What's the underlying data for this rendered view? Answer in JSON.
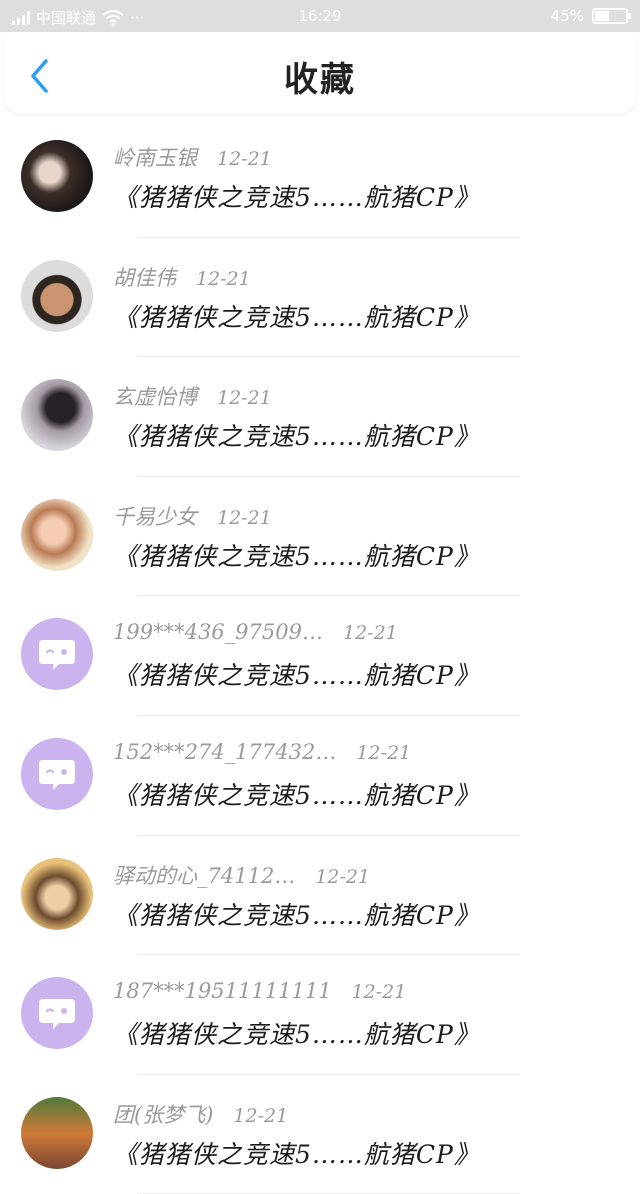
{
  "status_bar": {
    "carrier": "中国联通",
    "more": "···",
    "time": "16:29",
    "battery_pct": "45%",
    "battery_level": 0.45,
    "icons": [
      "signal-icon",
      "wifi-icon",
      "battery-icon"
    ]
  },
  "header": {
    "title": "收藏",
    "back_icon": "chevron-left-icon",
    "accent": "#2a9df4"
  },
  "items": [
    {
      "name": "岭南玉银",
      "date": "12-21",
      "title": "《猪猪侠之竞速5……航猪CP》",
      "avatar": "photo1"
    },
    {
      "name": "胡佳伟",
      "date": "12-21",
      "title": "《猪猪侠之竞速5……航猪CP》",
      "avatar": "photo2"
    },
    {
      "name": "玄虚怡博",
      "date": "12-21",
      "title": "《猪猪侠之竞速5……航猪CP》",
      "avatar": "photo3"
    },
    {
      "name": "千易少女",
      "date": "12-21",
      "title": "《猪猪侠之竞速5……航猪CP》",
      "avatar": "photo4"
    },
    {
      "name": "199***436_97509…",
      "date": "12-21",
      "title": "《猪猪侠之竞速5……航猪CP》",
      "avatar": "default"
    },
    {
      "name": "152***274_177432…",
      "date": "12-21",
      "title": "《猪猪侠之竞速5……航猪CP》",
      "avatar": "default"
    },
    {
      "name": "驿动的心_74112…",
      "date": "12-21",
      "title": "《猪猪侠之竞速5……航猪CP》",
      "avatar": "photo5"
    },
    {
      "name": "187***19511111111",
      "date": "12-21",
      "title": "《猪猪侠之竞速5……航猪CP》",
      "avatar": "default"
    },
    {
      "name": "团(张梦飞)",
      "date": "12-21",
      "title": "《猪猪侠之竞速5……航猪CP》",
      "avatar": "photo6"
    }
  ]
}
